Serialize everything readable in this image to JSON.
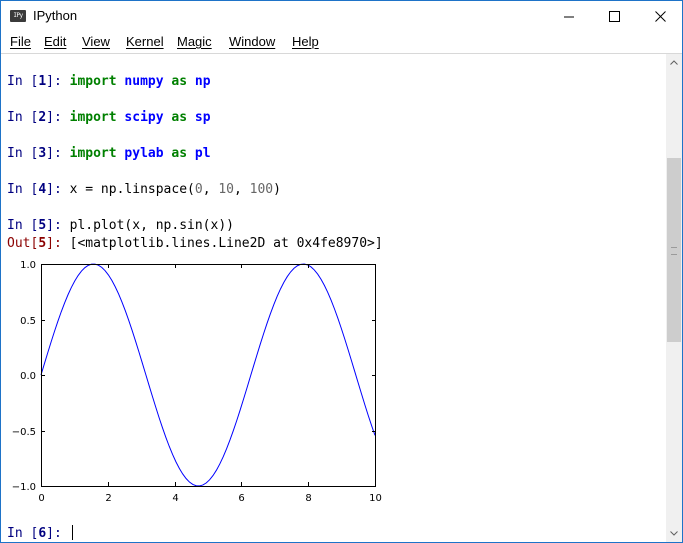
{
  "window": {
    "title": "IPython",
    "app_icon_text": "IPy",
    "icons": {
      "app": "ipython-icon",
      "minimize": "minimize-icon",
      "maximize": "maximize-icon",
      "close": "close-icon"
    }
  },
  "menu": [
    "File",
    "Edit",
    "View",
    "Kernel",
    "Magic",
    "Window",
    "Help"
  ],
  "console": {
    "cells": [
      {
        "prompt": "In [",
        "num": "1",
        "suffix": "]: ",
        "kw": "import",
        "mod": "numpy",
        "as": "as",
        "alias": "np"
      },
      {
        "prompt": "In [",
        "num": "2",
        "suffix": "]: ",
        "kw": "import",
        "mod": "scipy",
        "as": "as",
        "alias": "sp"
      },
      {
        "prompt": "In [",
        "num": "3",
        "suffix": "]: ",
        "kw": "import",
        "mod": "pylab",
        "as": "as",
        "alias": "pl"
      }
    ],
    "in4": {
      "prompt": "In [",
      "num": "4",
      "suffix": "]: ",
      "code_a": "x = np.linspace(",
      "n1": "0",
      "c1": ", ",
      "n2": "10",
      "c2": ", ",
      "n3": "100",
      "code_b": ")"
    },
    "in5": {
      "prompt": "In [",
      "num": "5",
      "suffix": "]: ",
      "code": "pl.plot(x, np.sin(x))"
    },
    "out5": {
      "prompt": "Out[",
      "num": "5",
      "suffix": "]: ",
      "text": "[<matplotlib.lines.Line2D at 0x4fe8970>]"
    },
    "in6": {
      "prompt": "In [",
      "num": "6",
      "suffix": "]: "
    }
  },
  "chart_data": {
    "type": "line",
    "function": "sin(x)",
    "x_start": 0,
    "x_end": 10,
    "num_points": 100,
    "xlim": [
      0,
      10
    ],
    "ylim": [
      -1.0,
      1.0
    ],
    "xticks": [
      "0",
      "2",
      "4",
      "6",
      "8",
      "10"
    ],
    "yticks": [
      "1.0",
      "0.5",
      "0.0",
      "−0.5",
      "−1.0"
    ],
    "series": [
      {
        "color": "#0000ff"
      }
    ],
    "grid": false
  },
  "scrollbar": {
    "icons": {
      "up": "scroll-up-arrow-icon",
      "down": "scroll-down-arrow-icon"
    }
  }
}
